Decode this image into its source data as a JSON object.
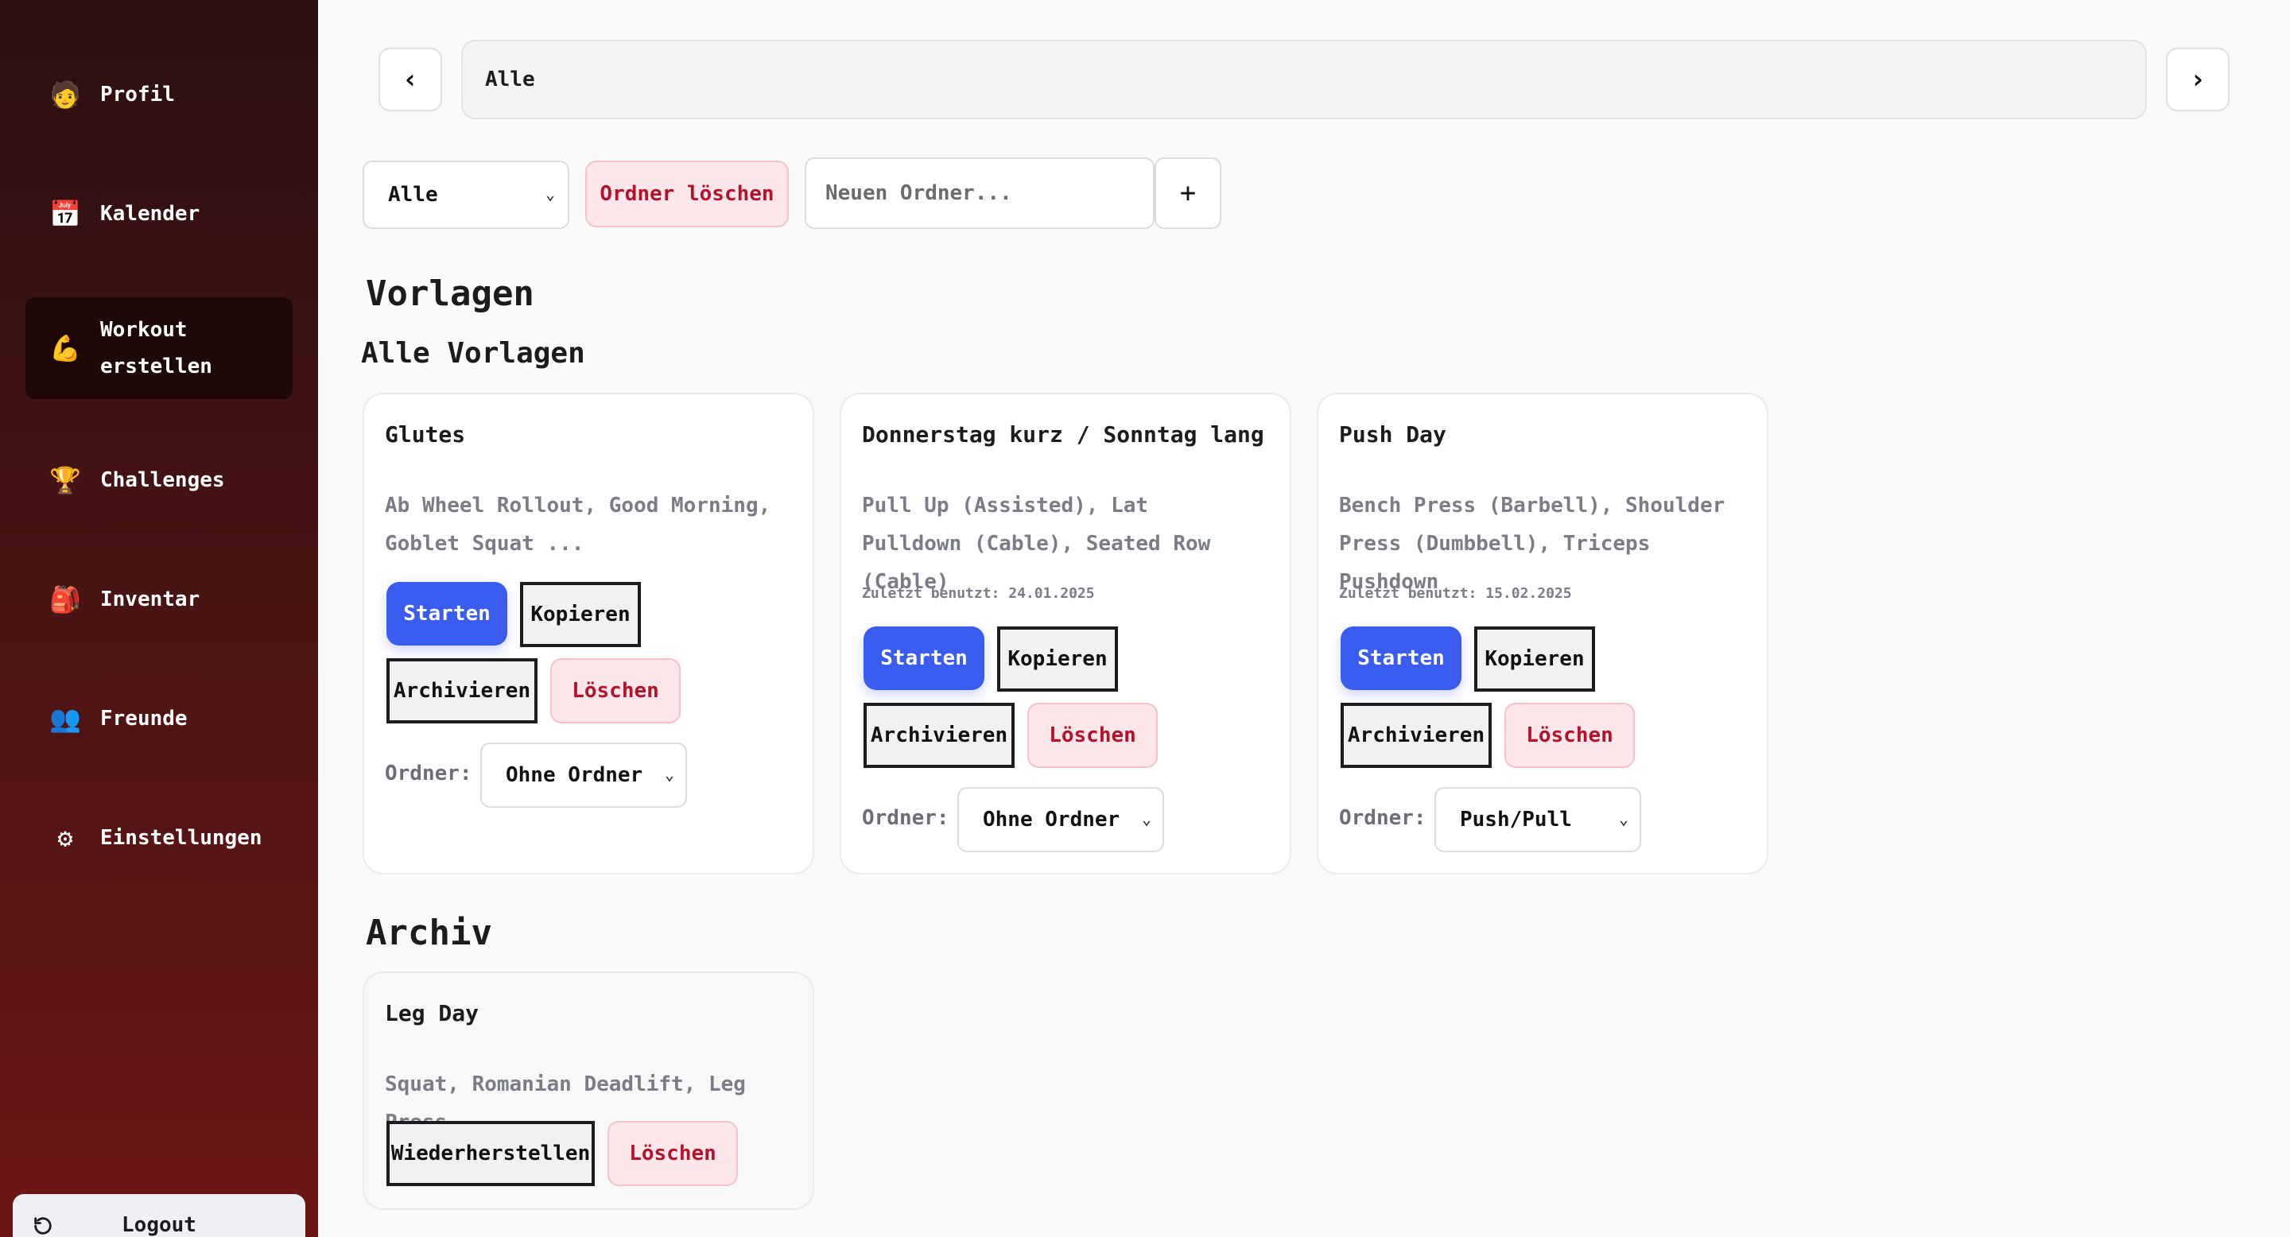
{
  "sidebar": {
    "items": [
      {
        "label": "Profil",
        "icon": "person-icon",
        "glyph": "🧑"
      },
      {
        "label": "Kalender",
        "icon": "calendar-icon",
        "glyph": "📅"
      },
      {
        "label": "Workout\nerstellen",
        "icon": "flexed-biceps-icon",
        "glyph": "💪",
        "active": true
      },
      {
        "label": "Challenges",
        "icon": "trophy-icon",
        "glyph": "🏆"
      },
      {
        "label": "Inventar",
        "icon": "backpack-icon",
        "glyph": "🎒"
      },
      {
        "label": "Freunde",
        "icon": "friends-icon",
        "glyph": "👥"
      },
      {
        "label": "Einstellungen",
        "icon": "gear-icon",
        "glyph": "⚙"
      }
    ],
    "logout_label": "Logout"
  },
  "topbar": {
    "prev_glyph": "‹",
    "next_glyph": "›",
    "current": "Alle"
  },
  "filters": {
    "folder_select_value": "Alle",
    "delete_folder_label": "Ordner löschen",
    "new_folder_placeholder": "Neuen Ordner...",
    "add_glyph": "+"
  },
  "sections": {
    "templates_heading": "Vorlagen",
    "all_templates_heading": "Alle Vorlagen",
    "archive_heading": "Archiv"
  },
  "labels": {
    "start": "Starten",
    "copy": "Kopieren",
    "archive": "Archivieren",
    "delete": "Löschen",
    "restore": "Wiederherstellen",
    "folder": "Ordner:"
  },
  "templates": [
    {
      "title": "Glutes",
      "exercises": "Ab Wheel Rollout, Good Morning, Goblet Squat ...",
      "last_used": "",
      "folder": "Ohne Ordner"
    },
    {
      "title": "Donnerstag kurz / Sonntag lang",
      "exercises": "Pull Up (Assisted), Lat Pulldown (Cable), Seated Row (Cable)",
      "last_used": "Zuletzt benutzt: 24.01.2025",
      "folder": "Ohne Ordner"
    },
    {
      "title": "Push Day",
      "exercises": "Bench Press (Barbell), Shoulder Press (Dumbbell), Triceps Pushdown",
      "last_used": "Zuletzt benutzt: 15.02.2025",
      "folder": "Push/Pull"
    }
  ],
  "archive": [
    {
      "title": "Leg Day",
      "exercises": "Squat, Romanian Deadlift, Leg Press"
    }
  ]
}
